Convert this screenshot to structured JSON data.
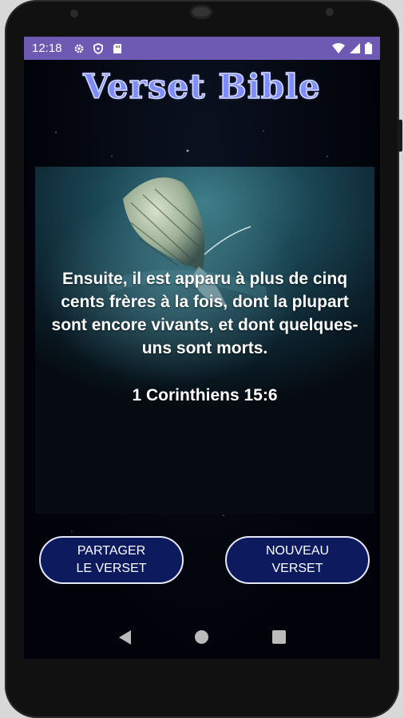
{
  "status_bar": {
    "time": "12:18",
    "icons_left": [
      "gear-icon",
      "shield-icon",
      "sd-card-icon"
    ],
    "icons_right": [
      "wifi-icon",
      "signal-icon",
      "battery-icon"
    ],
    "color": "#6e59b3"
  },
  "app": {
    "title": "Verset Bible",
    "title_color": "#7d8dff"
  },
  "verse": {
    "text": "Ensuite, il est apparu à plus de cinq cents frères à la fois, dont la plupart sont encore vivants, et dont quelques-uns sont morts.",
    "reference": "1 Corinthiens 15:6",
    "image": "butterfly-image"
  },
  "buttons": {
    "share": {
      "line1": "PARTAGER",
      "line2": "LE VERSET"
    },
    "new": {
      "line1": "NOUVEAU",
      "line2": "VERSET"
    },
    "color": "#0d1a5e"
  },
  "nav": {
    "icons": [
      "back-icon",
      "home-icon",
      "recents-icon"
    ]
  }
}
